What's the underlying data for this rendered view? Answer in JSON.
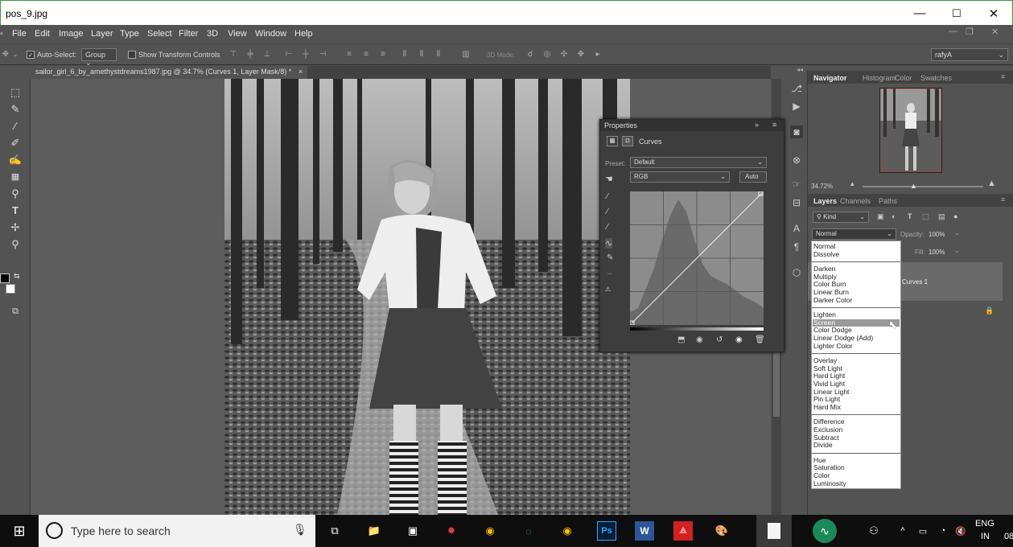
{
  "window": {
    "title": "pos_9.jpg",
    "minimize": "—",
    "maximize": "☐",
    "close": "✕"
  },
  "menu": [
    "File",
    "Edit",
    "Image",
    "Layer",
    "Type",
    "Select",
    "Filter",
    "3D",
    "View",
    "Window",
    "Help"
  ],
  "doc_controls": {
    "min": "—",
    "restore": "❐",
    "close": "✕"
  },
  "options": {
    "auto_select_label": "Auto-Select:",
    "auto_select_value": "Group",
    "show_transform": "Show Transform Controls",
    "mode_3d": "3D Mode:",
    "workspace": "rafyA"
  },
  "document_tab": {
    "title": "sailor_girl_6_by_amethystdreams1987.jpg @ 34.7% (Curves 1, Layer Mask/8) *",
    "close": "×"
  },
  "properties": {
    "title": "Properties",
    "panel_name": "Curves",
    "preset_label": "Preset:",
    "preset_value": "Default",
    "channel": "RGB",
    "auto_button": "Auto"
  },
  "navigator": {
    "tabs": [
      "Navigator",
      "Histogram",
      "Color",
      "Swatches"
    ],
    "zoom": "34.72%"
  },
  "layers": {
    "tabs": [
      "Layers",
      "Channels",
      "Paths"
    ],
    "filter_kind": "Kind",
    "blend_mode": "Normal",
    "opacity_label": "Opacity:",
    "opacity_value": "100%",
    "fill_label": "Fill:",
    "fill_value": "100%",
    "layer_name": "Curves 1"
  },
  "blend_groups": [
    [
      "Normal",
      "Dissolve"
    ],
    [
      "Darken",
      "Multiply",
      "Color Burn",
      "Linear Burn",
      "Darker Color"
    ],
    [
      "Lighten",
      "Screen",
      "Color Dodge",
      "Linear Dodge (Add)",
      "Lighter Color"
    ],
    [
      "Overlay",
      "Soft Light",
      "Hard Light",
      "Vivid Light",
      "Linear Light",
      "Pin Light",
      "Hard Mix"
    ],
    [
      "Difference",
      "Exclusion",
      "Subtract",
      "Divide"
    ],
    [
      "Hue",
      "Saturation",
      "Color",
      "Luminosity"
    ]
  ],
  "blend_highlighted": "Screen",
  "taskbar": {
    "search_placeholder": "Type here to search",
    "lang_top": "ENG",
    "lang_bottom": "IN",
    "clock": "08"
  },
  "colors": {
    "accent": "#1e90ff",
    "photoshop": "#31a8ff",
    "taskbar": "#0e0e0e"
  }
}
